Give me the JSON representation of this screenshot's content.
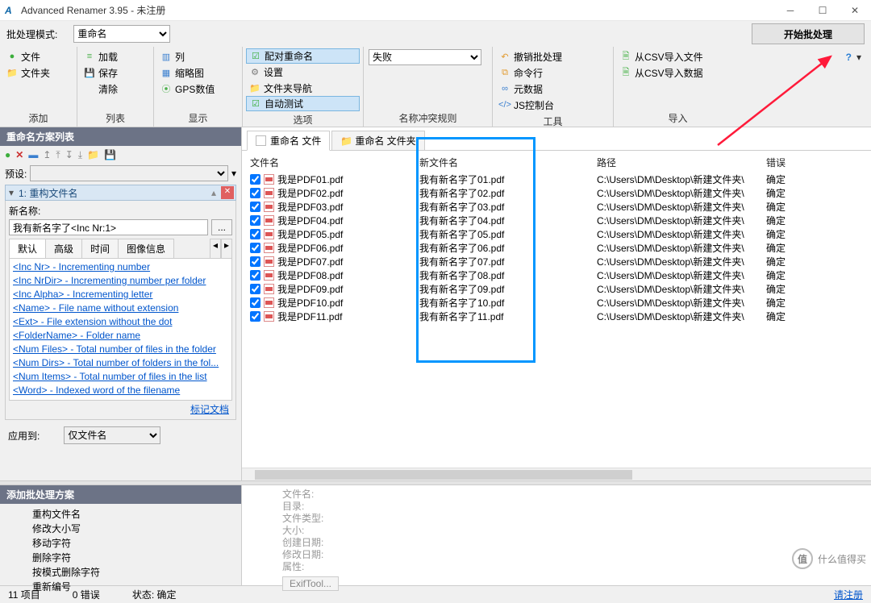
{
  "window": {
    "title": "Advanced Renamer 3.95 - 未注册"
  },
  "batch": {
    "label": "批处理模式:",
    "mode": "重命名",
    "start": "开始批处理"
  },
  "ribbon": {
    "add": {
      "caption": "添加",
      "files": "文件",
      "folders": "文件夹"
    },
    "list": {
      "caption": "列表",
      "load": "加载",
      "save": "保存",
      "clear": "清除"
    },
    "display": {
      "caption": "显示",
      "columns": "列",
      "thumbs": "缩略图",
      "gps": "GPS数值"
    },
    "options": {
      "caption": "选项",
      "pair": "配对重命名",
      "settings": "设置",
      "foldernav": "文件夹导航",
      "autotest": "自动测试"
    },
    "conflict": {
      "caption": "名称冲突规则",
      "value": "失败"
    },
    "tools": {
      "caption": "工具",
      "undo": "撤销批处理",
      "cmd": "命令行",
      "meta": "元数据",
      "js": "JS控制台"
    },
    "import": {
      "caption": "导入",
      "csvfile": "从CSV导入文件",
      "csvdata": "从CSV导入数据"
    }
  },
  "methods": {
    "header": "重命名方案列表",
    "preset_label": "预设:",
    "m1": {
      "title": "1: 重构文件名",
      "newname_label": "新名称:",
      "newname_value": "我有新名字了<Inc Nr:1>"
    },
    "tabs": {
      "default": "默认",
      "advanced": "高级",
      "time": "时间",
      "image": "图像信息"
    },
    "tags": [
      "<Inc Nr>  - Incrementing number",
      "<Inc NrDir>  - Incrementing number per folder",
      "<Inc Alpha> - Incrementing letter",
      "<Name>  - File name without extension",
      "<Ext>  - File extension without the dot",
      "<FolderName>  - Folder name",
      "<Num Files>  - Total number of files in the folder",
      "<Num Dirs>  - Total number of folders in the fol...",
      "<Num Items>  - Total number of files in the list",
      "<Word>  - Indexed word of the filename"
    ],
    "tagdoc": "标记文档",
    "apply_label": "应用到:",
    "apply_value": "仅文件名"
  },
  "addscheme": {
    "header": "添加批处理方案",
    "items": [
      "重构文件名",
      "修改大小写",
      "移动字符",
      "删除字符",
      "按模式删除字符",
      "重新编号"
    ]
  },
  "filetabs": {
    "files": "重命名 文件",
    "folders": "重命名 文件夹"
  },
  "columns": {
    "name": "文件名",
    "newname": "新文件名",
    "path": "路径",
    "error": "错误"
  },
  "rows": [
    {
      "name": "我是PDF01.pdf",
      "new": "我有新名字了01.pdf",
      "path": "C:\\Users\\DM\\Desktop\\新建文件夹\\",
      "err": "确定"
    },
    {
      "name": "我是PDF02.pdf",
      "new": "我有新名字了02.pdf",
      "path": "C:\\Users\\DM\\Desktop\\新建文件夹\\",
      "err": "确定"
    },
    {
      "name": "我是PDF03.pdf",
      "new": "我有新名字了03.pdf",
      "path": "C:\\Users\\DM\\Desktop\\新建文件夹\\",
      "err": "确定"
    },
    {
      "name": "我是PDF04.pdf",
      "new": "我有新名字了04.pdf",
      "path": "C:\\Users\\DM\\Desktop\\新建文件夹\\",
      "err": "确定"
    },
    {
      "name": "我是PDF05.pdf",
      "new": "我有新名字了05.pdf",
      "path": "C:\\Users\\DM\\Desktop\\新建文件夹\\",
      "err": "确定"
    },
    {
      "name": "我是PDF06.pdf",
      "new": "我有新名字了06.pdf",
      "path": "C:\\Users\\DM\\Desktop\\新建文件夹\\",
      "err": "确定"
    },
    {
      "name": "我是PDF07.pdf",
      "new": "我有新名字了07.pdf",
      "path": "C:\\Users\\DM\\Desktop\\新建文件夹\\",
      "err": "确定"
    },
    {
      "name": "我是PDF08.pdf",
      "new": "我有新名字了08.pdf",
      "path": "C:\\Users\\DM\\Desktop\\新建文件夹\\",
      "err": "确定"
    },
    {
      "name": "我是PDF09.pdf",
      "new": "我有新名字了09.pdf",
      "path": "C:\\Users\\DM\\Desktop\\新建文件夹\\",
      "err": "确定"
    },
    {
      "name": "我是PDF10.pdf",
      "new": "我有新名字了10.pdf",
      "path": "C:\\Users\\DM\\Desktop\\新建文件夹\\",
      "err": "确定"
    },
    {
      "name": "我是PDF11.pdf",
      "new": "我有新名字了11.pdf",
      "path": "C:\\Users\\DM\\Desktop\\新建文件夹\\",
      "err": "确定"
    }
  ],
  "details": {
    "filename": "文件名:",
    "dir": "目录:",
    "type": "文件类型:",
    "size": "大小:",
    "created": "创建日期:",
    "modified": "修改日期:",
    "attrs": "属性:",
    "exif": "ExifTool..."
  },
  "status": {
    "items": "11 项目",
    "errors": "0 错误",
    "state_label": "状态:",
    "state": "确定",
    "register": "请注册"
  },
  "watermark": {
    "text": "什么值得买",
    "badge": "值"
  }
}
